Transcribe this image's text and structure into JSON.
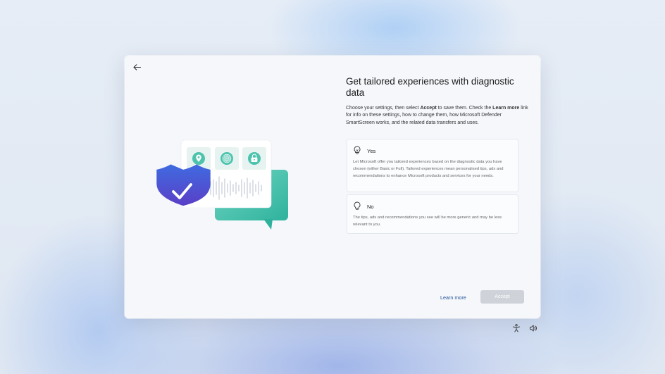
{
  "dialog": {
    "title": "Get tailored experiences with diagnostic data",
    "description": {
      "part1": "Choose your settings, then select ",
      "accept_bold": "Accept",
      "part2": " to save them. Check the ",
      "learn_more_bold": "Learn more",
      "part3": " link for info on these settings, how to change them, how Microsoft Defender SmartScreen works, and the related data transfers and uses."
    },
    "options": [
      {
        "label": "Yes",
        "icon": "lightbulb-on-icon",
        "text": "Let Microsoft offer you tailored experiences based on the diagnostic data you have chosen (either Basic or Full). Tailored experiences mean personalised tips, ads and recommendations to enhance Microsoft products and services for your needs."
      },
      {
        "label": "No",
        "icon": "lightbulb-off-icon",
        "text": "The tips, ads and recommendations you see will be more generic and may be less relevant to you."
      }
    ],
    "learn_more_label": "Learn more",
    "accept_label": "Accept",
    "back_icon": "back-arrow-icon"
  },
  "illustration": {
    "icons": [
      "location-pin-icon",
      "fingerprint-icon",
      "lock-icon",
      "shield-check-icon",
      "audio-waveform-icon"
    ]
  },
  "tray": {
    "icons": [
      "accessibility-icon",
      "volume-icon"
    ]
  },
  "colors": {
    "accent_teal": "#4cc3ad",
    "shield_blue": "#3d5fd6",
    "link": "#1f4f96",
    "accept_disabled": "#cfd3d9"
  }
}
